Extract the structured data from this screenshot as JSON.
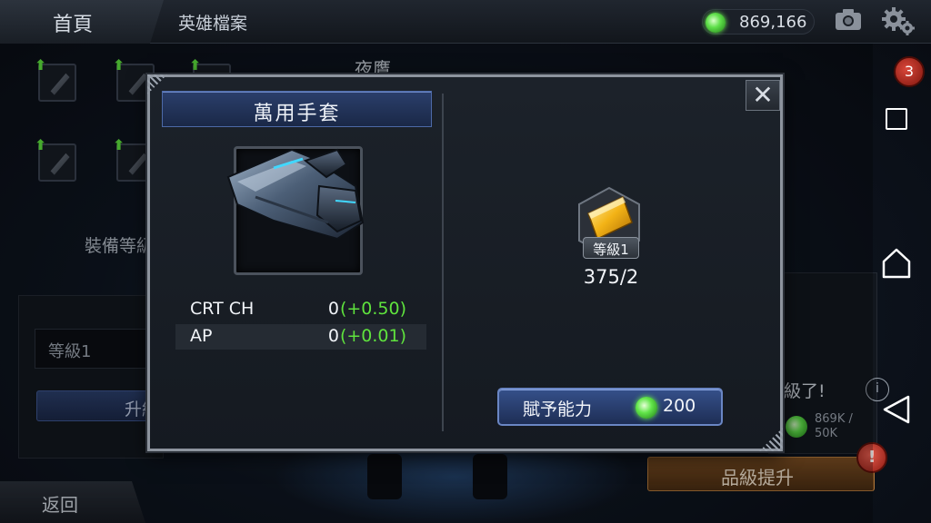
{
  "topbar": {
    "home_label": "首頁",
    "section_title": "英雄檔案",
    "currency_amount": "869,166"
  },
  "background": {
    "character_name": "夜鷹",
    "equipment_level_label": "裝備等級",
    "level_field": "等級1",
    "upgrade_label": "升級",
    "ready_text": "級了!",
    "info_symbol": "i",
    "cost_text_line1": "869K /",
    "cost_text_line2": "50K",
    "rank_up_label": "品級提升",
    "rank_up_alert": "!",
    "notification_count": "3",
    "back_label": "返回"
  },
  "modal": {
    "item_name": "萬用手套",
    "stats": [
      {
        "name": "CRT CH",
        "value": "0",
        "bonus": "(+0.50)"
      },
      {
        "name": "AP",
        "value": "0",
        "bonus": "(+0.01)"
      }
    ],
    "catalyst_level": "等級1",
    "catalyst_count": "375/2",
    "grant_label": "賦予能力",
    "grant_cost": "200",
    "close_symbol": "✕"
  },
  "colors": {
    "accent_blue": "#2b3f6b",
    "bonus_green": "#5fe33d",
    "gem_green": "#5fe04a",
    "rank_up_orange": "#7a4d22",
    "alert_red": "#d9473a"
  },
  "icons": [
    "camera-icon",
    "gear-icon",
    "gem-icon",
    "close-icon",
    "info-icon",
    "gauntlet-icon",
    "catalyst-icon",
    "upgrade-arrow-icon",
    "nav-recents-icon",
    "nav-home-icon",
    "nav-back-icon"
  ]
}
